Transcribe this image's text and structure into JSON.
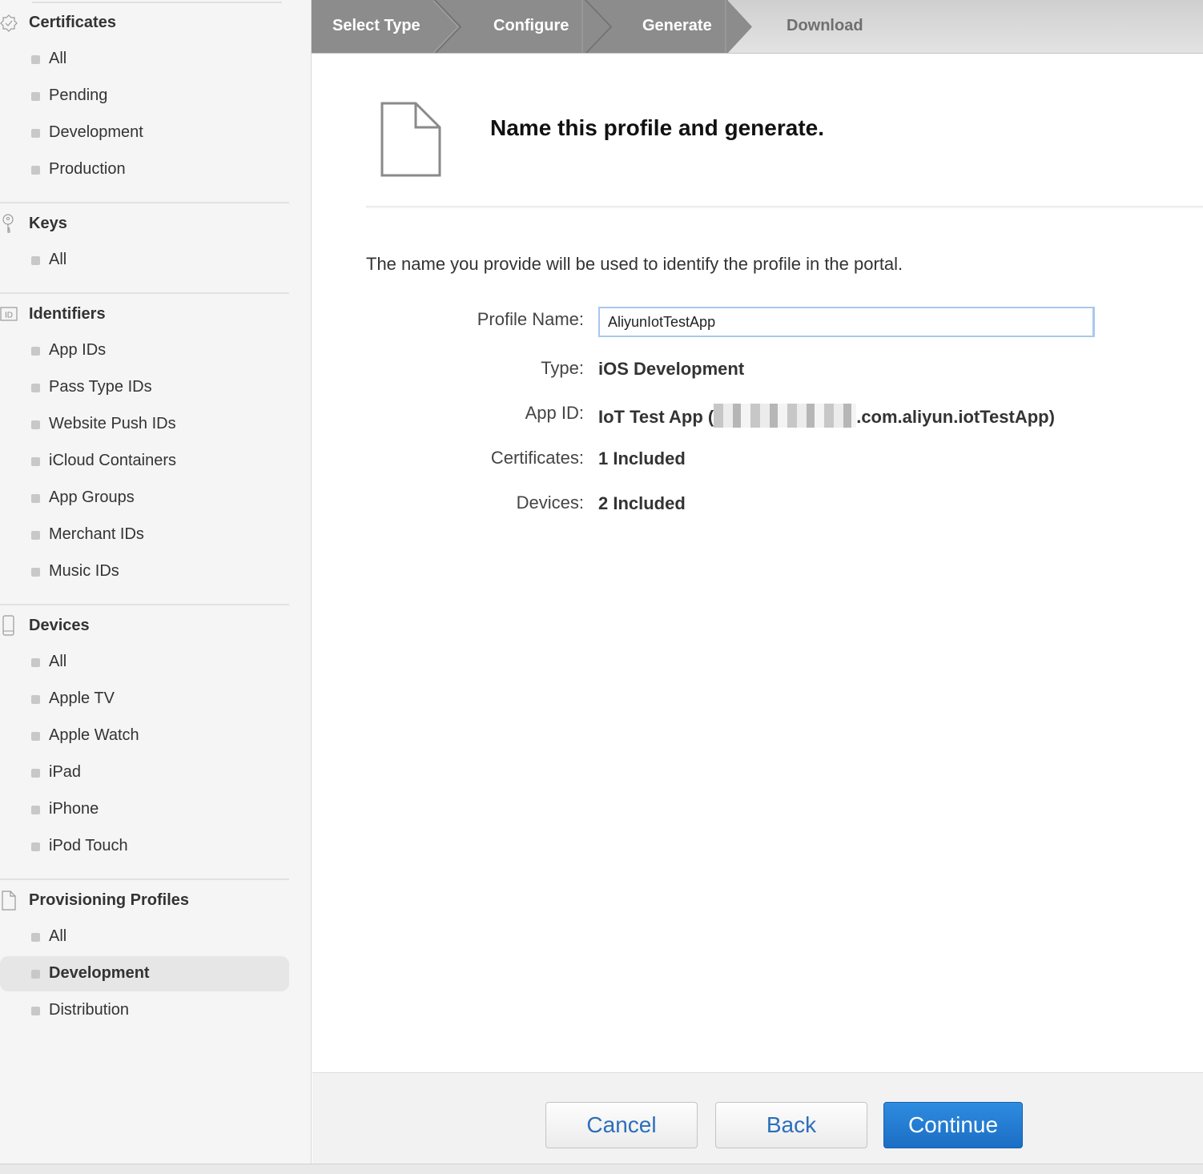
{
  "sidebar": {
    "sections": [
      {
        "title": "Certificates",
        "icon": "certificate-badge-icon",
        "items": [
          "All",
          "Pending",
          "Development",
          "Production"
        ]
      },
      {
        "title": "Keys",
        "icon": "key-icon",
        "items": [
          "All"
        ]
      },
      {
        "title": "Identifiers",
        "icon": "id-icon",
        "icon_text": "ID",
        "items": [
          "App IDs",
          "Pass Type IDs",
          "Website Push IDs",
          "iCloud Containers",
          "App Groups",
          "Merchant IDs",
          "Music IDs"
        ]
      },
      {
        "title": "Devices",
        "icon": "device-icon",
        "items": [
          "All",
          "Apple TV",
          "Apple Watch",
          "iPad",
          "iPhone",
          "iPod Touch"
        ]
      },
      {
        "title": "Provisioning Profiles",
        "icon": "profile-doc-icon",
        "items": [
          "All",
          "Development",
          "Distribution"
        ],
        "active_item": "Development"
      }
    ]
  },
  "steps": [
    {
      "label": "Select Type",
      "state": "done"
    },
    {
      "label": "Configure",
      "state": "done"
    },
    {
      "label": "Generate",
      "state": "current"
    },
    {
      "label": "Download",
      "state": "todo"
    }
  ],
  "main": {
    "icon": "document-icon",
    "title": "Name this profile and generate.",
    "description": "The name you provide will be used to identify the profile in the portal.",
    "fields": {
      "profile_name_label": "Profile Name:",
      "profile_name_value": "AliyunIotTestApp",
      "type_label": "Type:",
      "type_value": "iOS Development",
      "app_id_label": "App ID:",
      "app_id_prefix": "IoT Test App (",
      "app_id_suffix": ".com.aliyun.iotTestApp)",
      "certificates_label": "Certificates:",
      "certificates_value": "1 Included",
      "devices_label": "Devices:",
      "devices_value": "2 Included"
    }
  },
  "footer": {
    "cancel_label": "Cancel",
    "back_label": "Back",
    "continue_label": "Continue"
  },
  "colors": {
    "primary_button": "#1f77cf",
    "link_text": "#2c6fba",
    "step_done": "#8c8c8c",
    "input_focus": "#a9c8ee"
  }
}
